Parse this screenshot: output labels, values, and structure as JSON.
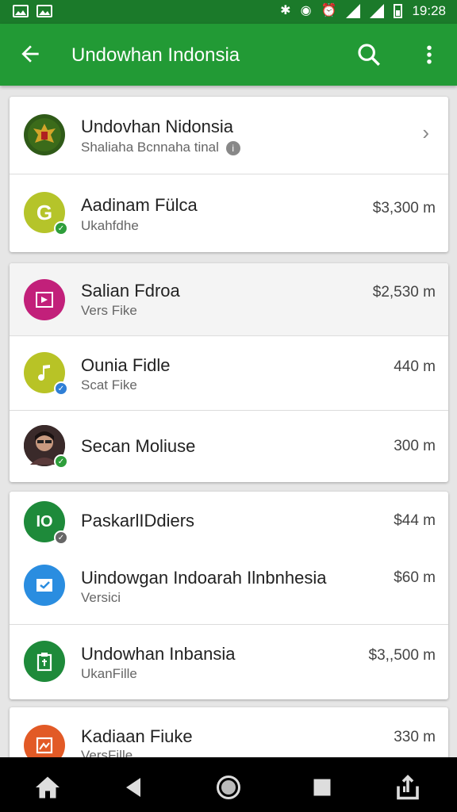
{
  "status_bar": {
    "time": "19:28",
    "icons": [
      "image-icon",
      "image-icon",
      "bluetooth-icon",
      "wifi-icon",
      "alarm-icon",
      "signal-icon",
      "signal-icon",
      "battery-icon"
    ]
  },
  "app_bar": {
    "title": "Undowhan Indonsia",
    "back_icon": "arrow-back-icon",
    "search_icon": "search-icon",
    "more_icon": "more-vert-icon",
    "color": "#229a35"
  },
  "cards": [
    {
      "rows": [
        {
          "title": "Undovhan Nidonsia",
          "subtitle": "Shaliaha Bcnnaha tinal",
          "value": "",
          "avatar": "garuda-emblem-icon",
          "has_chevron": true
        },
        {
          "title": "Aadinam Fülca",
          "subtitle": "Ukahfdhe",
          "value": "$3,300 m",
          "avatar": "G",
          "avatar_color": "#b5c42a",
          "badge_color": "#2e9e3b"
        }
      ]
    },
    {
      "rows": [
        {
          "title": "Salian Fdroa",
          "subtitle": "Vers Fike",
          "value": "$2,530 m",
          "avatar_icon": "play-box-icon",
          "avatar_color": "#c2207a"
        },
        {
          "title": "Ounia Fidle",
          "subtitle": "Scat Fike",
          "value": "440 m",
          "avatar_icon": "music-note-icon",
          "avatar_color": "#b8c326",
          "badge_color": "#2f7fd6"
        },
        {
          "title": "Secan Moliuse",
          "subtitle": "",
          "value": "300 m",
          "avatar_icon": "profile-photo",
          "avatar_color": "#5a3a3a",
          "badge_color": "#2e9e3b"
        }
      ]
    },
    {
      "rows": [
        {
          "title": "PaskarlIDdiers",
          "subtitle": "",
          "value": "$44 m",
          "avatar": "IO",
          "avatar_color": "#1e8a3a",
          "badge_color": "#666666"
        },
        {
          "title": "Uindowgan Indoarah Ilnbnhesia",
          "subtitle": "Versici",
          "value": "$60 m",
          "avatar_icon": "check-box-icon",
          "avatar_color": "#2a8de0"
        },
        {
          "title": "Undowhan Inbansia",
          "subtitle": "UkanFille",
          "value": "$3,,500 m",
          "avatar_icon": "clipboard-icon",
          "avatar_color": "#1e8a3a"
        }
      ]
    },
    {
      "rows": [
        {
          "title": "Kadiaan Fiuke",
          "subtitle": "VersFille",
          "value": "330 m",
          "avatar_icon": "image-icon",
          "avatar_color": "#e25a26"
        }
      ]
    }
  ],
  "nav_bar": {
    "items": [
      "home-icon",
      "back-triangle-icon",
      "home-circle-icon",
      "recents-square-icon",
      "share-icon"
    ]
  }
}
